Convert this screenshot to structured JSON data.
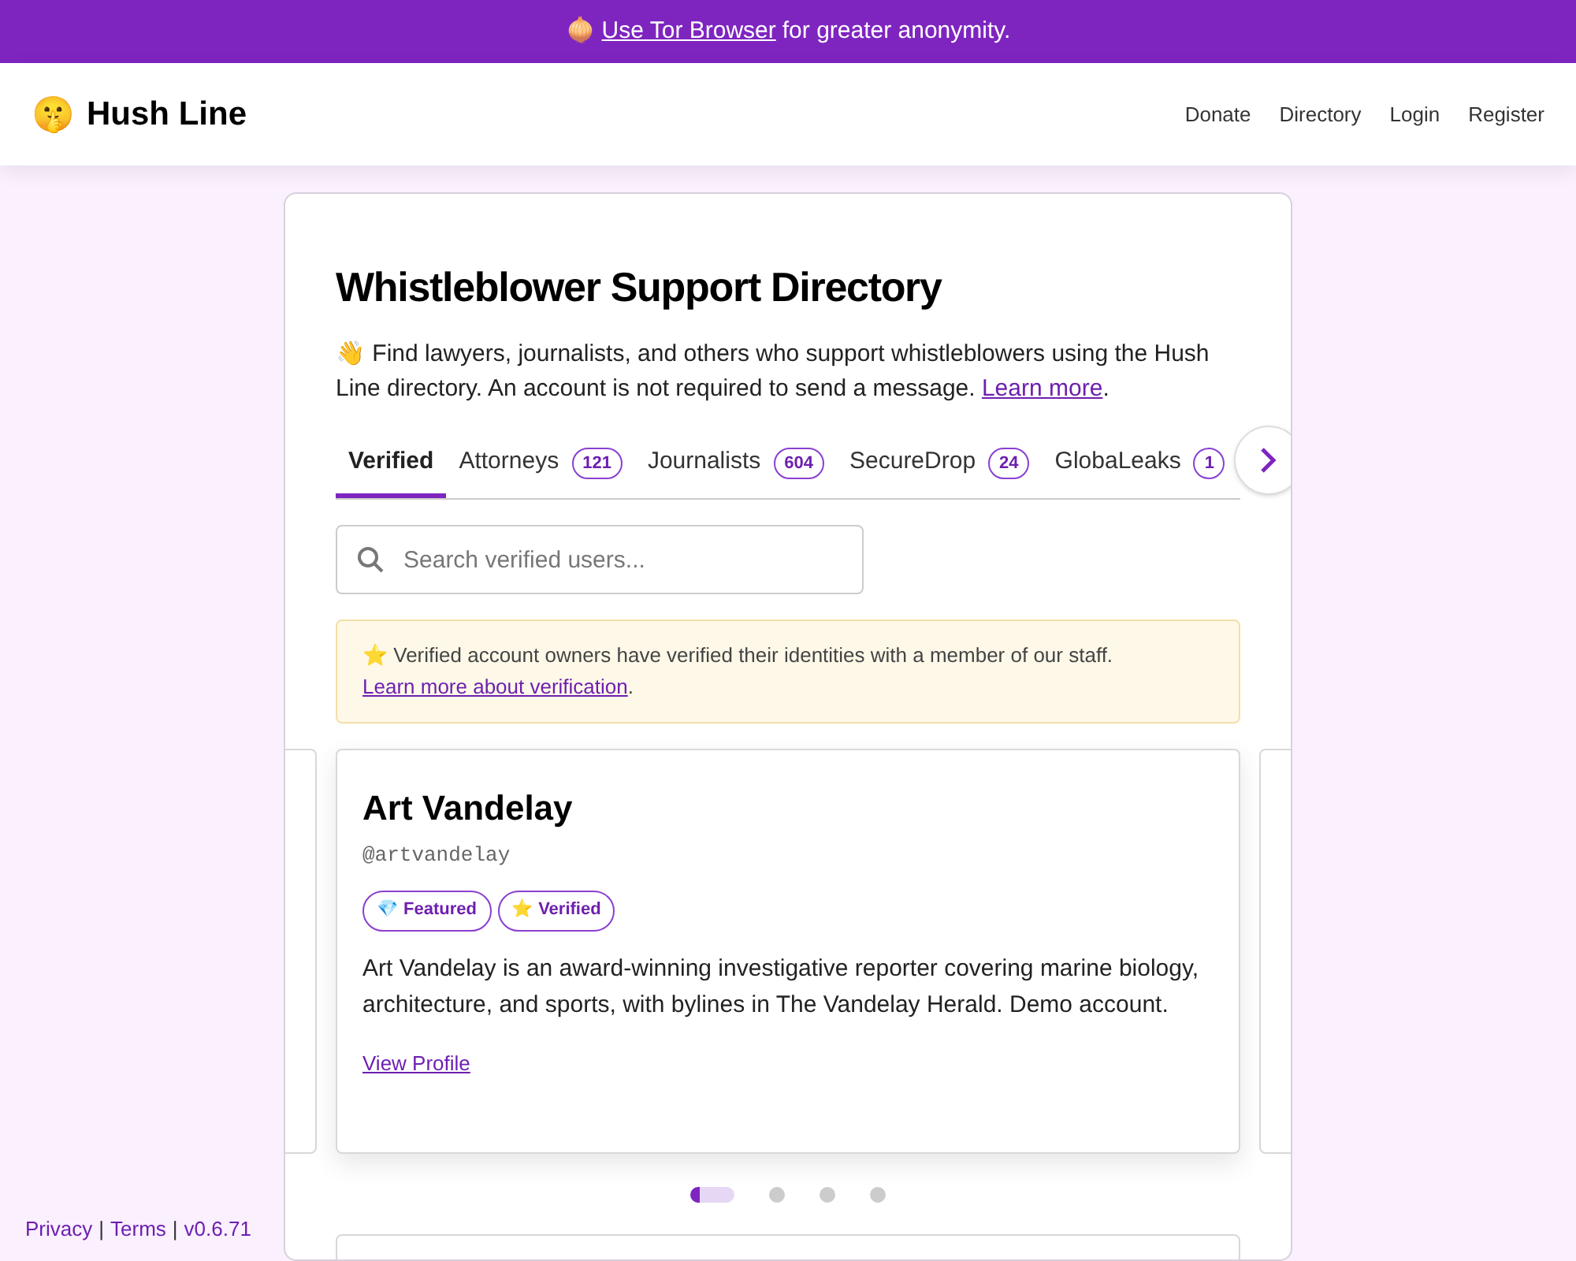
{
  "banner": {
    "emoji": "🧅",
    "link": "Use Tor Browser",
    "text": "for greater anonymity."
  },
  "header": {
    "logo_emoji": "🤫",
    "title": "Hush Line",
    "nav": [
      "Donate",
      "Directory",
      "Login",
      "Register"
    ]
  },
  "page": {
    "title": "Whistleblower Support Directory",
    "intro_emoji": "👋",
    "intro": "Find lawyers, journalists, and others who support whistleblowers using the Hush Line directory. An account is not required to send a message.",
    "intro_link": "Learn more",
    "intro_end": "."
  },
  "tabs": [
    {
      "label": "Verified",
      "selected": true
    },
    {
      "label": "Attorneys",
      "count": "121",
      "selected": false
    },
    {
      "label": "Journalists",
      "count": "604",
      "selected": false
    },
    {
      "label": "SecureDrop",
      "count": "24",
      "selected": false
    },
    {
      "label": "GlobaLeaks",
      "count": "1",
      "selected": false
    }
  ],
  "search": {
    "placeholder": "Search verified users..."
  },
  "notice": {
    "emoji": "⭐",
    "text": "Verified account owners have verified their identities with a member of our staff.",
    "link": "Learn more about verification",
    "end": "."
  },
  "profile": {
    "name": "Art Vandelay",
    "handle": "@artvandelay",
    "badges": [
      {
        "emoji": "💎",
        "label": "Featured"
      },
      {
        "emoji": "⭐",
        "label": "Verified"
      }
    ],
    "bio": "Art Vandelay is an award-winning investigative reporter covering marine biology, architecture, and sports, with bylines in The Vandelay Herald. Demo account.",
    "link": "View Profile"
  },
  "carousel_dots": [
    {
      "selected": true
    },
    {
      "selected": false
    },
    {
      "selected": false
    },
    {
      "selected": false
    }
  ],
  "footer": {
    "links": [
      "Privacy",
      "Terms"
    ],
    "separator": "|",
    "version": "v0.6.71"
  }
}
